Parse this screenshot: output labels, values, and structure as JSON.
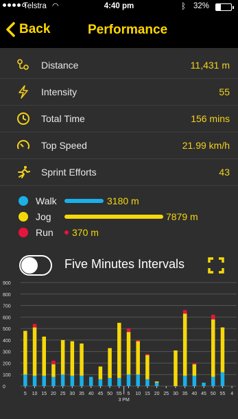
{
  "status_bar": {
    "carrier": "Telstra",
    "time": "4:40 pm",
    "battery": "32%",
    "battery_level": 0.32,
    "icons": [
      "signal-dots",
      "wifi-icon",
      "bluetooth-icon",
      "battery-icon"
    ]
  },
  "nav": {
    "back_label": "Back",
    "title": "Performance",
    "accent_color": "#ffd700"
  },
  "stats": [
    {
      "icon": "location-path-icon",
      "label": "Distance",
      "value": "11,431 m"
    },
    {
      "icon": "lightning-icon",
      "label": "Intensity",
      "value": "55"
    },
    {
      "icon": "clock-icon",
      "label": "Total Time",
      "value": "156 mins"
    },
    {
      "icon": "speedometer-icon",
      "label": "Top Speed",
      "value": "21.99 km/h"
    },
    {
      "icon": "sprinter-icon",
      "label": "Sprint Efforts",
      "value": "43"
    }
  ],
  "legend": [
    {
      "name": "Walk",
      "value": "3180 m",
      "color": "#1ab0e8"
    },
    {
      "name": "Jog",
      "value": "7879 m",
      "color": "#f5d80a"
    },
    {
      "name": "Run",
      "value": "370 m",
      "color": "#e8143c"
    }
  ],
  "interval_toggle": {
    "label": "Five Minutes Intervals",
    "on": false
  },
  "chart_data": {
    "type": "bar",
    "stacked": true,
    "ylim": [
      0,
      900
    ],
    "y_ticks": [
      "0",
      "100",
      "200",
      "300",
      "400",
      "500",
      "600",
      "700",
      "800",
      "900"
    ],
    "categories": [
      "5",
      "10",
      "15",
      "20",
      "25",
      "30",
      "35",
      "40",
      "45",
      "50",
      "55",
      "5",
      "10",
      "15",
      "20",
      "25",
      "30",
      "35",
      "40",
      "45",
      "50",
      "55",
      "4"
    ],
    "marker_label": "3 PM",
    "series": [
      {
        "name": "Walk",
        "color": "#1ab0e8",
        "values": [
          100,
          90,
          90,
          80,
          100,
          90,
          90,
          80,
          60,
          70,
          70,
          100,
          100,
          60,
          30,
          0,
          0,
          90,
          90,
          30,
          80,
          120,
          0
        ]
      },
      {
        "name": "Jog",
        "color": "#f5d80a",
        "values": [
          380,
          420,
          340,
          110,
          300,
          300,
          280,
          0,
          110,
          260,
          480,
          370,
          290,
          210,
          10,
          0,
          310,
          540,
          100,
          0,
          500,
          390,
          0
        ]
      },
      {
        "name": "Run",
        "color": "#e8143c",
        "values": [
          0,
          30,
          0,
          30,
          0,
          0,
          0,
          0,
          0,
          0,
          0,
          30,
          10,
          10,
          0,
          0,
          0,
          30,
          10,
          0,
          40,
          0,
          0
        ]
      }
    ]
  }
}
